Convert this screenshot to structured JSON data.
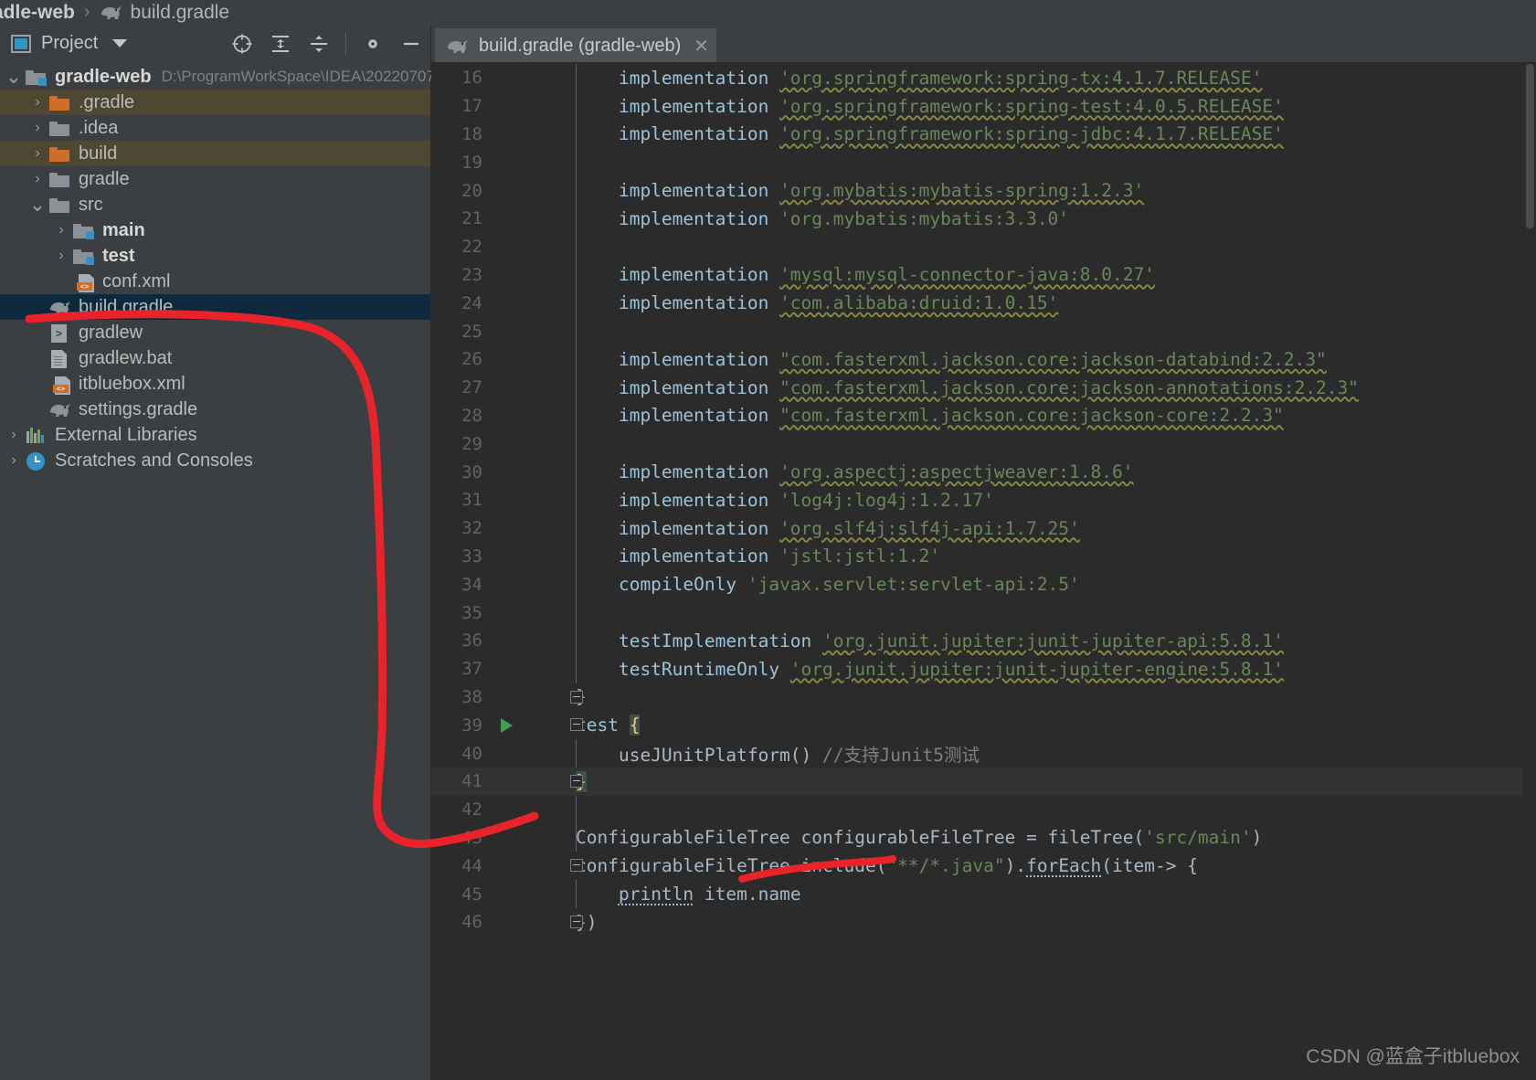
{
  "breadcrumb": {
    "project": "adle-web",
    "separator": "›",
    "file": "build.gradle",
    "file_icon": "gradle-elephant-icon"
  },
  "project_panel": {
    "toolbar": {
      "view_label": "Project",
      "view_icon": "project-view-icon",
      "caret_icon": "chevron-down-icon",
      "buttons": [
        {
          "name": "select-opened-file-icon",
          "tooltip": "Select Opened File"
        },
        {
          "name": "expand-all-icon",
          "tooltip": "Expand All"
        },
        {
          "name": "collapse-all-icon",
          "tooltip": "Collapse All"
        },
        {
          "name": "gear-icon",
          "tooltip": "Settings"
        },
        {
          "name": "hide-icon",
          "tooltip": "Hide"
        }
      ]
    },
    "tree": [
      {
        "label": "gradle-web",
        "note": "D:\\ProgramWorkSpace\\IDEA\\20220707",
        "icon": "module-folder-icon",
        "arrow": "expanded",
        "depth": 0,
        "bold": true,
        "highlight": "none"
      },
      {
        "label": ".gradle",
        "note": "",
        "icon": "folder-orange-icon",
        "arrow": "collapsed",
        "depth": 1,
        "bold": false,
        "highlight": "olive"
      },
      {
        "label": ".idea",
        "note": "",
        "icon": "folder-grey-icon",
        "arrow": "collapsed",
        "depth": 1,
        "bold": false,
        "highlight": "none"
      },
      {
        "label": "build",
        "note": "",
        "icon": "folder-orange-icon",
        "arrow": "collapsed",
        "depth": 1,
        "bold": false,
        "highlight": "olive"
      },
      {
        "label": "gradle",
        "note": "",
        "icon": "folder-grey-icon",
        "arrow": "collapsed",
        "depth": 1,
        "bold": false,
        "highlight": "none"
      },
      {
        "label": "src",
        "note": "",
        "icon": "folder-grey-icon",
        "arrow": "expanded",
        "depth": 1,
        "bold": false,
        "highlight": "none"
      },
      {
        "label": "main",
        "note": "",
        "icon": "source-folder-icon",
        "arrow": "collapsed",
        "depth": 2,
        "bold": true,
        "highlight": "none"
      },
      {
        "label": "test",
        "note": "",
        "icon": "test-source-folder-icon",
        "arrow": "collapsed",
        "depth": 2,
        "bold": true,
        "highlight": "none"
      },
      {
        "label": "conf.xml",
        "note": "",
        "icon": "xml-file-icon",
        "arrow": "none",
        "depth": 2,
        "bold": false,
        "highlight": "none"
      },
      {
        "label": "build.gradle",
        "note": "",
        "icon": "gradle-file-icon",
        "arrow": "none",
        "depth": 1,
        "bold": false,
        "highlight": "selected"
      },
      {
        "label": "gradlew",
        "note": "",
        "icon": "shell-script-icon",
        "arrow": "none",
        "depth": 1,
        "bold": false,
        "highlight": "none"
      },
      {
        "label": "gradlew.bat",
        "note": "",
        "icon": "text-file-icon",
        "arrow": "none",
        "depth": 1,
        "bold": false,
        "highlight": "none"
      },
      {
        "label": "itbluebox.xml",
        "note": "",
        "icon": "xml-file-icon",
        "arrow": "none",
        "depth": 1,
        "bold": false,
        "highlight": "none"
      },
      {
        "label": "settings.gradle",
        "note": "",
        "icon": "gradle-file-icon",
        "arrow": "none",
        "depth": 1,
        "bold": false,
        "highlight": "none"
      },
      {
        "label": "External Libraries",
        "note": "",
        "icon": "libraries-icon",
        "arrow": "collapsed",
        "depth": 0,
        "bold": false,
        "highlight": "none"
      },
      {
        "label": "Scratches and Consoles",
        "note": "",
        "icon": "scratches-icon",
        "arrow": "collapsed",
        "depth": 0,
        "bold": false,
        "highlight": "none"
      }
    ]
  },
  "editor": {
    "tab": {
      "title": "build.gradle (gradle-web)",
      "icon": "gradle-elephant-icon",
      "close_icon": "close-icon"
    },
    "first_line_number": 16,
    "caret_line": 41,
    "run_marker_line": 39,
    "lines": [
      {
        "n": 16,
        "segs": [
          {
            "t": "    implementation ",
            "c": "meth"
          },
          {
            "t": "'org.springframework:spring-tx:4.1.7.RELEASE'",
            "c": "str squig"
          }
        ]
      },
      {
        "n": 17,
        "segs": [
          {
            "t": "    implementation ",
            "c": "meth"
          },
          {
            "t": "'org.springframework:spring-test:4.0.5.RELEASE'",
            "c": "str squig"
          }
        ]
      },
      {
        "n": 18,
        "segs": [
          {
            "t": "    implementation ",
            "c": "meth"
          },
          {
            "t": "'org.springframework:spring-jdbc:4.1.7.RELEASE'",
            "c": "str squig"
          }
        ]
      },
      {
        "n": 19,
        "segs": []
      },
      {
        "n": 20,
        "segs": [
          {
            "t": "    implementation ",
            "c": "meth"
          },
          {
            "t": "'org.mybatis:mybatis-spring:1.2.3'",
            "c": "str squig"
          }
        ]
      },
      {
        "n": 21,
        "segs": [
          {
            "t": "    implementation ",
            "c": "meth"
          },
          {
            "t": "'org.mybatis:mybatis:3.3.0'",
            "c": "str"
          }
        ]
      },
      {
        "n": 22,
        "segs": []
      },
      {
        "n": 23,
        "segs": [
          {
            "t": "    implementation ",
            "c": "meth"
          },
          {
            "t": "'mysql:mysql-connector-java:8.0.27'",
            "c": "str squig"
          }
        ]
      },
      {
        "n": 24,
        "segs": [
          {
            "t": "    implementation ",
            "c": "meth"
          },
          {
            "t": "'com.alibaba:druid:1.0.15'",
            "c": "str squig"
          }
        ]
      },
      {
        "n": 25,
        "segs": []
      },
      {
        "n": 26,
        "segs": [
          {
            "t": "    implementation ",
            "c": "meth"
          },
          {
            "t": "\"com.fasterxml.jackson.core:jackson-databind:2.2.3\"",
            "c": "str squig"
          }
        ]
      },
      {
        "n": 27,
        "segs": [
          {
            "t": "    implementation ",
            "c": "meth"
          },
          {
            "t": "\"com.fasterxml.jackson.core:jackson-annotations:2.2.3\"",
            "c": "str squig"
          }
        ]
      },
      {
        "n": 28,
        "segs": [
          {
            "t": "    implementation ",
            "c": "meth"
          },
          {
            "t": "\"com.fasterxml.jackson.core:jackson-core:2.2.3\"",
            "c": "str squig"
          }
        ]
      },
      {
        "n": 29,
        "segs": []
      },
      {
        "n": 30,
        "segs": [
          {
            "t": "    implementation ",
            "c": "meth"
          },
          {
            "t": "'org.aspectj:aspectjweaver:1.8.6'",
            "c": "str squig"
          }
        ]
      },
      {
        "n": 31,
        "segs": [
          {
            "t": "    implementation ",
            "c": "meth"
          },
          {
            "t": "'log4j:log4j:1.2.17'",
            "c": "str"
          }
        ]
      },
      {
        "n": 32,
        "segs": [
          {
            "t": "    implementation ",
            "c": "meth"
          },
          {
            "t": "'org.slf4j:slf4j-api:1.7.25'",
            "c": "str squig"
          }
        ]
      },
      {
        "n": 33,
        "segs": [
          {
            "t": "    implementation ",
            "c": "meth"
          },
          {
            "t": "'jstl:jstl:1.2'",
            "c": "str"
          }
        ]
      },
      {
        "n": 34,
        "segs": [
          {
            "t": "    compileOnly ",
            "c": "meth"
          },
          {
            "t": "'javax.servlet:servlet-api:2.5'",
            "c": "str"
          }
        ]
      },
      {
        "n": 35,
        "segs": []
      },
      {
        "n": 36,
        "segs": [
          {
            "t": "    testImplementation ",
            "c": "meth"
          },
          {
            "t": "'org.junit.jupiter:junit-jupiter-api:5.8.1'",
            "c": "str squig"
          }
        ]
      },
      {
        "n": 37,
        "segs": [
          {
            "t": "    testRuntimeOnly ",
            "c": "meth"
          },
          {
            "t": "'org.junit.jupiter:junit-jupiter-engine:5.8.1'",
            "c": "str squig"
          }
        ]
      },
      {
        "n": 38,
        "segs": [
          {
            "t": "}",
            "c": "plain"
          }
        ]
      },
      {
        "n": 39,
        "segs": [
          {
            "t": "test ",
            "c": "meth"
          },
          {
            "t": "{",
            "c": "brace-hl"
          }
        ]
      },
      {
        "n": 40,
        "segs": [
          {
            "t": "    useJUnitPlatform() ",
            "c": "plain"
          },
          {
            "t": "//支持Junit5测试",
            "c": "cmt"
          }
        ]
      },
      {
        "n": 41,
        "segs": [
          {
            "t": "}",
            "c": "brace-hl"
          }
        ]
      },
      {
        "n": 42,
        "segs": []
      },
      {
        "n": 43,
        "segs": [
          {
            "t": "ConfigurableFileTree configurableFileTree = fileTree(",
            "c": "plain"
          },
          {
            "t": "'src/main'",
            "c": "str"
          },
          {
            "t": ")",
            "c": "plain"
          }
        ]
      },
      {
        "n": 44,
        "segs": [
          {
            "t": "configurableFileTree.include(",
            "c": "plain"
          },
          {
            "t": "\"**/*.java\"",
            "c": "str"
          },
          {
            "t": ").",
            "c": "plain"
          },
          {
            "t": "forEach",
            "c": "plain dotted"
          },
          {
            "t": "(item-> {",
            "c": "plain"
          }
        ]
      },
      {
        "n": 45,
        "segs": [
          {
            "t": "    ",
            "c": "plain"
          },
          {
            "t": "println",
            "c": "plain dotted"
          },
          {
            "t": " item.name",
            "c": "plain"
          }
        ]
      },
      {
        "n": 46,
        "segs": [
          {
            "t": "})",
            "c": "plain"
          }
        ]
      }
    ]
  },
  "annotation": {
    "type": "red-handdrawn-marker",
    "color": "#E8232A",
    "strokes": 2
  },
  "watermark": {
    "text": "CSDN @蓝盒子itbluebox"
  },
  "colors": {
    "panel_bg": "#3C3F41",
    "editor_bg": "#2B2B2B",
    "selection": "#0D293E",
    "olive_highlight": "#4D4733",
    "string_green": "#6A8759",
    "method_blue": "#9CC1D9",
    "accent_blue": "#3592C4",
    "folder_orange": "#CC6F2B",
    "run_green": "#499C54",
    "annotation_red": "#E8232A"
  }
}
